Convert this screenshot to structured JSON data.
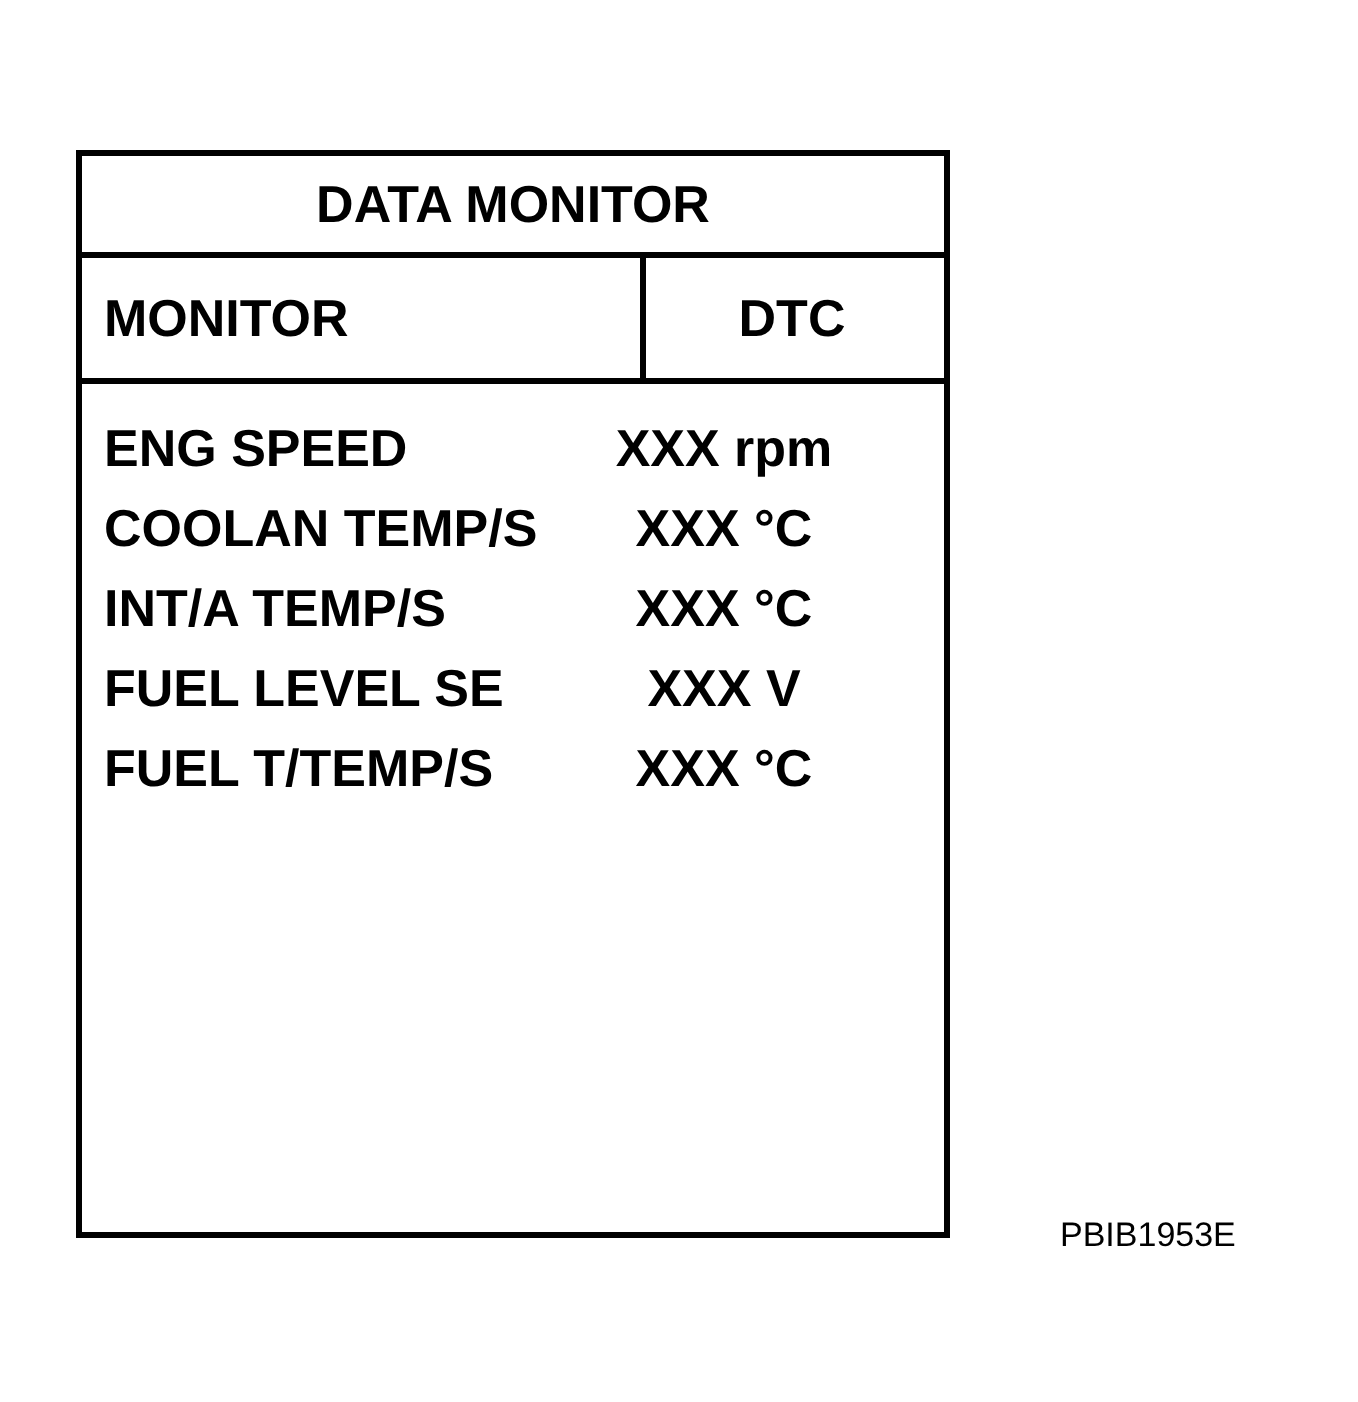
{
  "panel": {
    "title": "DATA MONITOR",
    "buttons": [
      "MONITOR",
      "DTC"
    ],
    "items": [
      {
        "label": "ENG SPEED",
        "value": "XXX rpm"
      },
      {
        "label": "COOLAN TEMP/S",
        "value": "XXX °C"
      },
      {
        "label": "INT/A TEMP/S",
        "value": "XXX °C"
      },
      {
        "label": "FUEL LEVEL SE",
        "value": "XXX V"
      },
      {
        "label": "FUEL T/TEMP/S",
        "value": "XXX °C"
      }
    ]
  },
  "figure_code": "PBIB1953E"
}
